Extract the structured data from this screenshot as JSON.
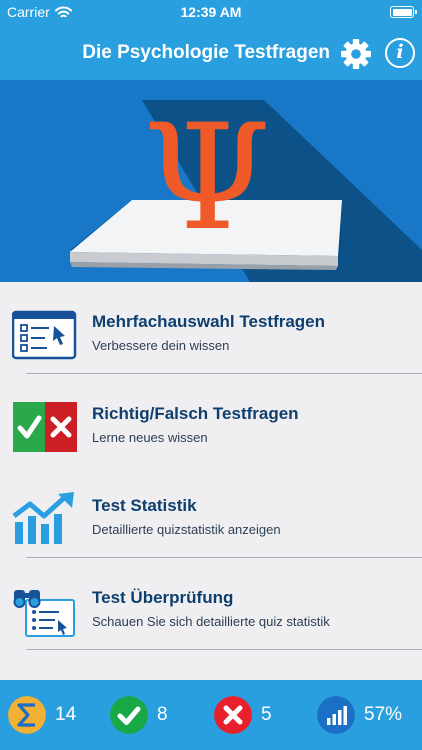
{
  "status_bar": {
    "carrier": "Carrier",
    "time": "12:39 AM"
  },
  "header": {
    "title": "Die Psychologie Testfragen",
    "settings_icon": "gear-icon",
    "info_icon": "info-icon",
    "info_glyph": "i"
  },
  "hero": {
    "symbol": "Ψ",
    "icon": "psi-on-paper-illustration"
  },
  "menu": {
    "items": [
      {
        "title": "Mehrfachauswahl Testfragen",
        "subtitle": "Verbessere dein wissen",
        "icon": "checklist-icon"
      },
      {
        "title": "Richtig/Falsch Testfragen",
        "subtitle": "Lerne neues wissen",
        "icon": "true-false-icon"
      },
      {
        "title": "Test Statistik",
        "subtitle": "Detaillierte quizstatistik anzeigen",
        "icon": "growth-chart-icon"
      },
      {
        "title": "Test Überprüfung",
        "subtitle": "Schauen Sie sich detaillierte quiz statistik",
        "icon": "review-binoculars-icon"
      }
    ]
  },
  "stats": {
    "total": {
      "value": "14",
      "icon": "sigma-icon",
      "color": "#f2b134"
    },
    "correct": {
      "value": "8",
      "icon": "check-icon",
      "color": "#18a846"
    },
    "wrong": {
      "value": "5",
      "icon": "cross-icon",
      "color": "#e8202c"
    },
    "percent": {
      "value": "57%",
      "icon": "progress-chart-icon",
      "color": "#1b6fc4"
    }
  },
  "colors": {
    "primary": "#2a9fe0",
    "hero_bg": "#1878c7",
    "psi": "#f05a28",
    "title_text": "#0e3f6e"
  }
}
